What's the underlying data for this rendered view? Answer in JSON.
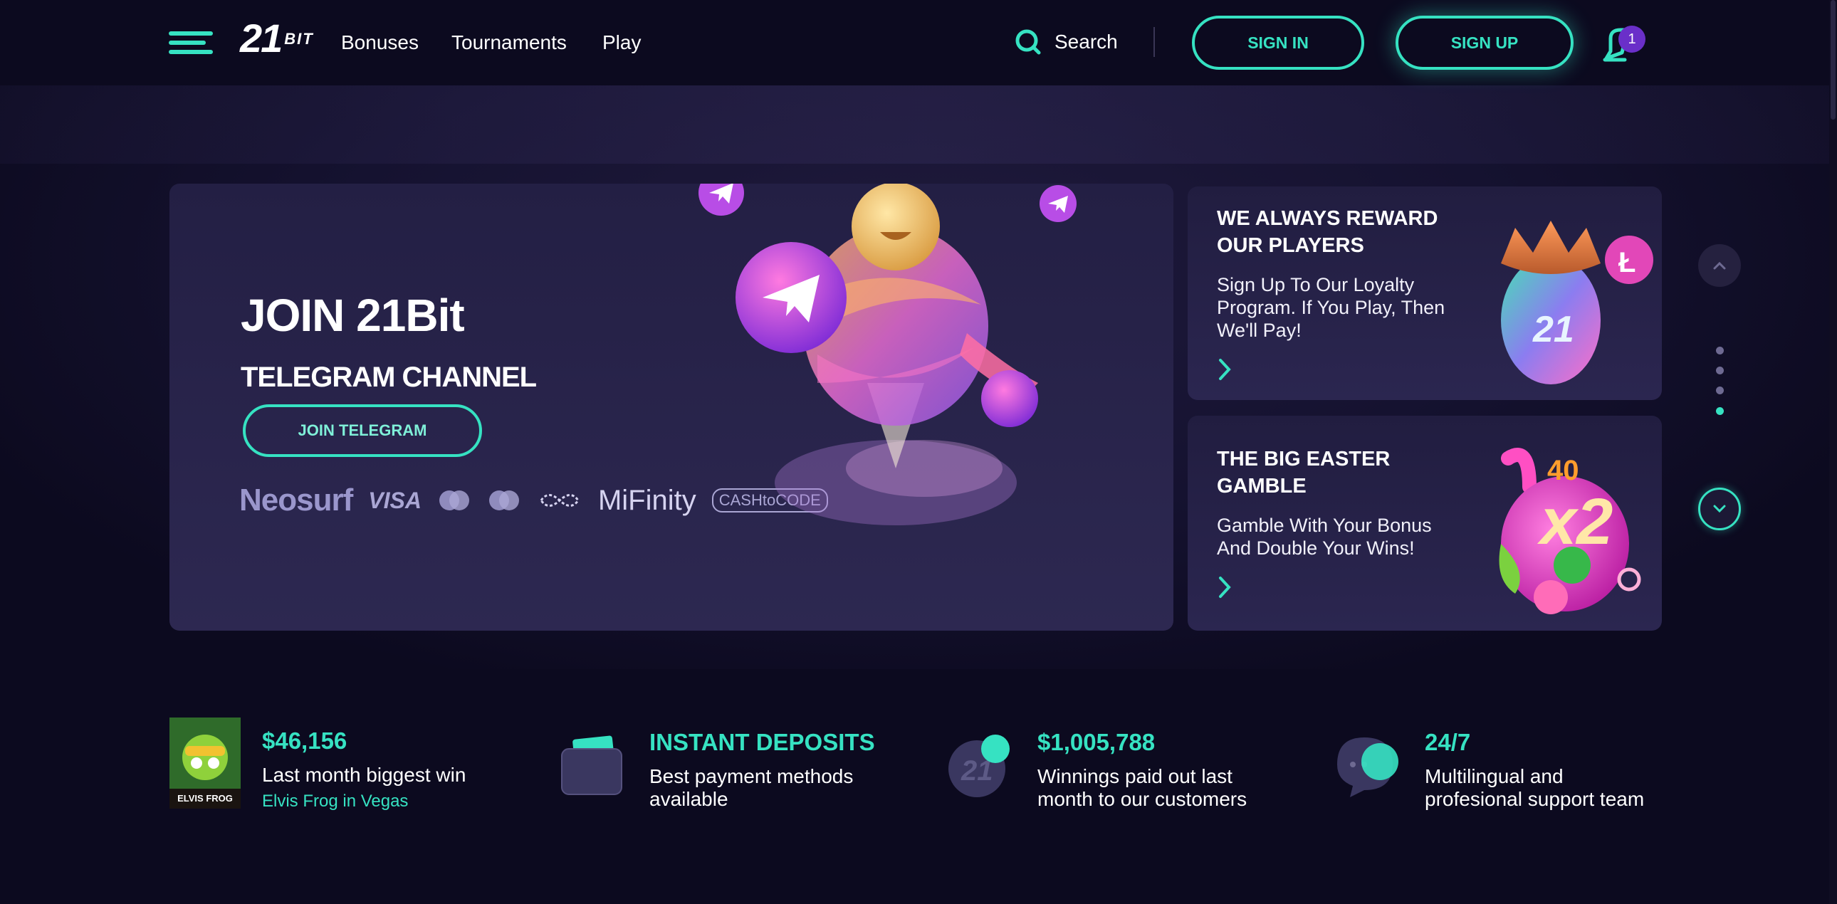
{
  "header": {
    "logo_main": "21",
    "logo_sub": "BIT",
    "nav": [
      "Bonuses",
      "Tournaments",
      "Play"
    ],
    "search_label": "Search",
    "sign_in": "SIGN IN",
    "sign_up": "SIGN UP",
    "notification_count": "1"
  },
  "hero": {
    "title": "JOIN 21Bit",
    "subtitle": "TELEGRAM CHANNEL",
    "button": "JOIN TELEGRAM",
    "payment_logos": [
      "Neosurf",
      "VISA",
      "MiFinity",
      "CASHtoCODE"
    ]
  },
  "promos": [
    {
      "title_line1": "WE ALWAYS REWARD",
      "title_line2": "OUR PLAYERS",
      "desc_line1": "Sign Up To Our Loyalty",
      "desc_line2": "Program. If You Play, Then",
      "desc_line3": "We'll Pay!"
    },
    {
      "title_line1": "THE BIG EASTER",
      "title_line2": "GAMBLE",
      "desc_line1": "Gamble With Your Bonus",
      "desc_line2": "And Double Your Wins!",
      "art_text_1": "40",
      "art_text_2": "x2"
    }
  ],
  "stats": [
    {
      "value": "$46,156",
      "line1": "Last month biggest win",
      "link": "Elvis Frog in Vegas",
      "thumb_caption": "ELVIS FROG"
    },
    {
      "value": "INSTANT DEPOSITS",
      "line1": "Best payment methods",
      "line2": "available"
    },
    {
      "value": "$1,005,788",
      "line1": "Winnings paid out last",
      "line2": "month to our customers"
    },
    {
      "value": "24/7",
      "line1": "Multilingual and",
      "line2": "profesional support team"
    }
  ],
  "colors": {
    "accent": "#36e2c2",
    "background": "#0c0a1f",
    "card": "#231f44",
    "badge": "#6a2fc9"
  }
}
